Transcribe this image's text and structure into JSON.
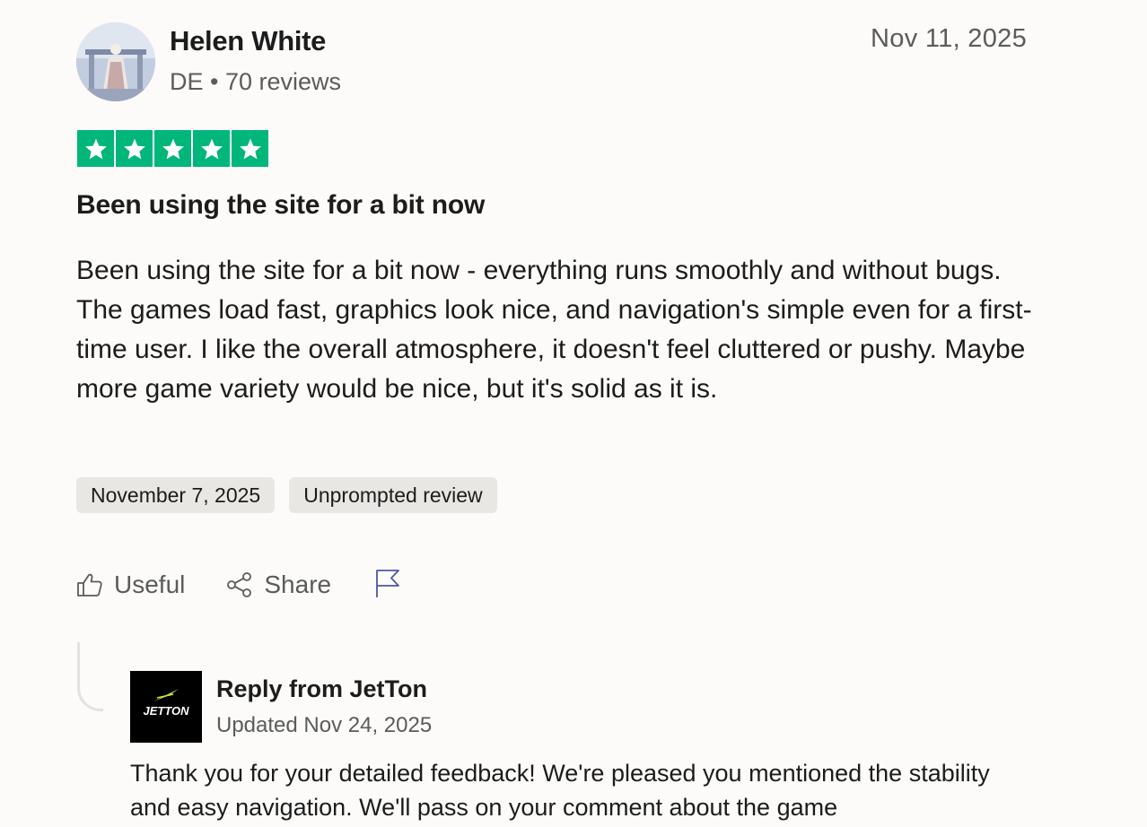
{
  "author": {
    "name": "Helen White",
    "country": "DE",
    "separator": "•",
    "reviews": "70 reviews"
  },
  "review": {
    "date": "Nov 11, 2025",
    "rating": 5,
    "rating_color": "#00b67a",
    "title": "Been using the site for a bit now",
    "body": "Been using the site for a bit now - everything runs smoothly and without bugs. The games load fast, graphics look nice, and navigation's simple even for a first-time user. I like the overall atmosphere, it doesn't feel cluttered or pushy. Maybe more game variety would be nice, but it's solid as it is.",
    "tags": {
      "experience_date": "November 7, 2025",
      "unprompted": "Unprompted review"
    }
  },
  "actions": {
    "useful_label": "Useful",
    "share_label": "Share"
  },
  "reply": {
    "title": "Reply from JetTon",
    "logo_text": "JETTON",
    "updated": "Updated Nov 24, 2025",
    "body": "Thank you for your detailed feedback! We're pleased you mentioned the stability and easy navigation. We'll pass on your comment about the game"
  }
}
